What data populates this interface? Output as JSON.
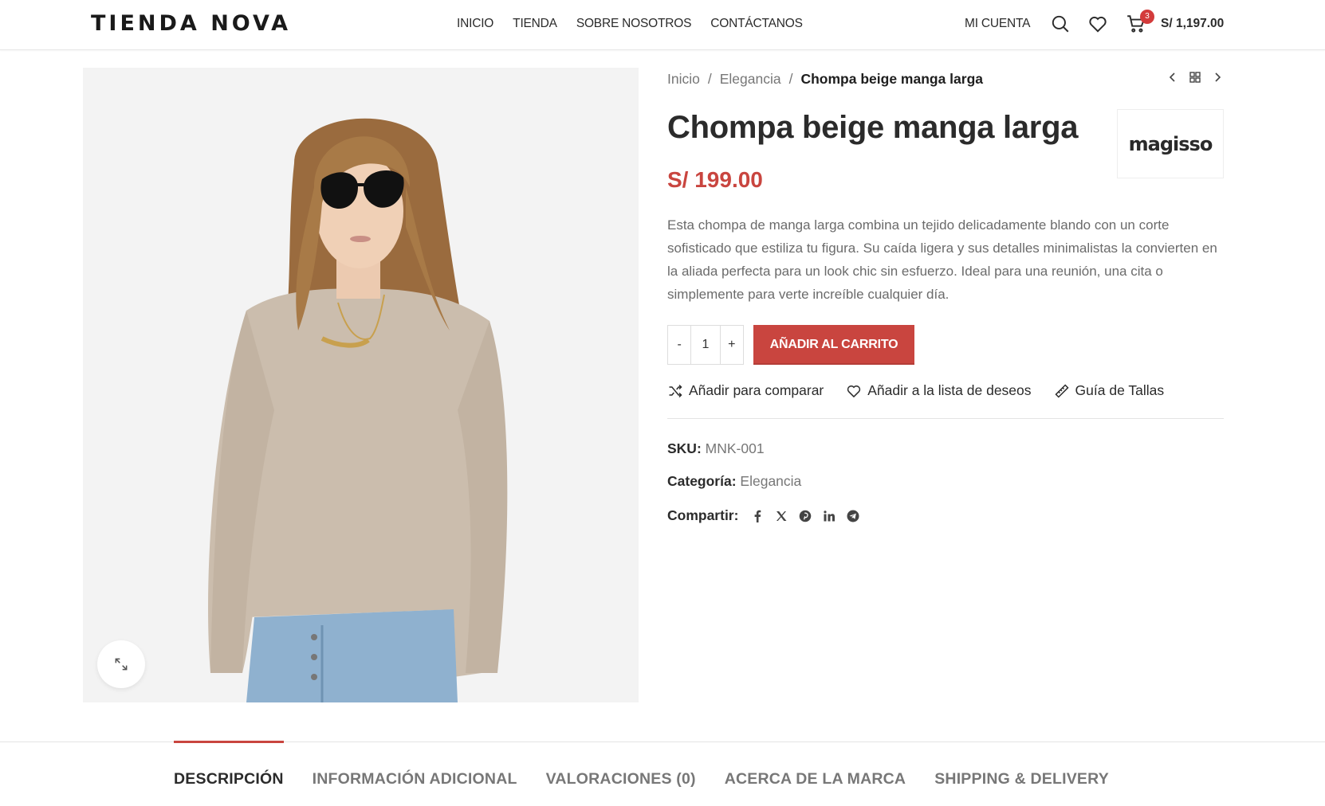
{
  "header": {
    "logo": "TIENDA NOVA",
    "nav": [
      "INICIO",
      "TIENDA",
      "SOBRE NOSOTROS",
      "CONTÁCTANOS"
    ],
    "account": "MI CUENTA",
    "cart_count": "3",
    "cart_total": "S/ 1,197.00",
    "icons": [
      "search-icon",
      "heart-icon",
      "cart-icon"
    ]
  },
  "breadcrumb": {
    "home": "Inicio",
    "category": "Elegancia",
    "current": "Chompa beige manga larga",
    "separator": "/"
  },
  "product": {
    "title": "Chompa beige manga larga",
    "brand": "magisso",
    "price": "S/ 199.00",
    "description": "Esta chompa de manga larga combina un tejido delicadamente blando con un corte sofisticado que estiliza tu figura. Su caída ligera y sus detalles minimalistas la convierten en la aliada perfecta para un look chic sin esfuerzo. Ideal para una reunión, una cita o simplemente para verte increíble cualquier día.",
    "quantity": "1",
    "qty_minus": "-",
    "qty_plus": "+",
    "add_to_cart": "AÑADIR AL CARRITO",
    "compare": "Añadir para comparar",
    "wishlist": "Añadir a la lista de deseos",
    "size_guide": "Guía de Tallas",
    "sku_label": "SKU:",
    "sku": "MNK-001",
    "category_label": "Categoría:",
    "category": "Elegancia",
    "share_label": "Compartir:",
    "share_icons": [
      "facebook-icon",
      "x-icon",
      "pinterest-icon",
      "linkedin-icon",
      "telegram-icon"
    ]
  },
  "tabs": [
    {
      "label": "DESCRIPCIÓN",
      "active": true
    },
    {
      "label": "INFORMACIÓN ADICIONAL",
      "active": false
    },
    {
      "label": "VALORACIONES (0)",
      "active": false
    },
    {
      "label": "ACERCA DE LA MARCA",
      "active": false
    },
    {
      "label": "SHIPPING & DELIVERY",
      "active": false
    }
  ],
  "colors": {
    "accent": "#c9453f",
    "text": "#2b2b2b",
    "muted": "#777777"
  }
}
